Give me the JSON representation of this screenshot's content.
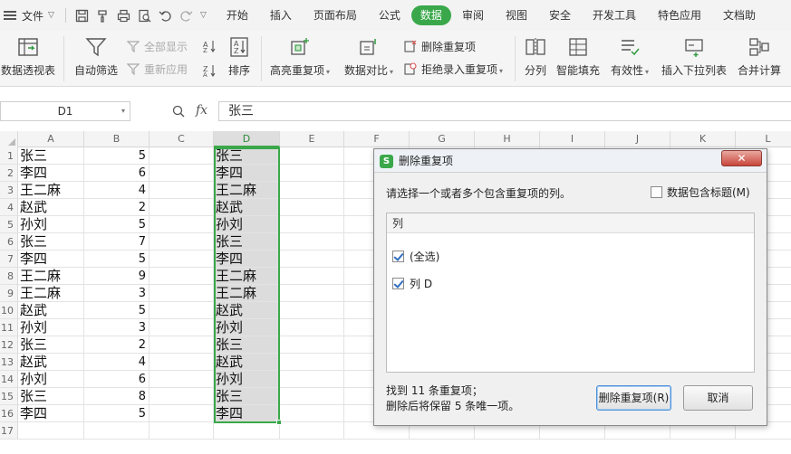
{
  "menubar": {
    "file_label": "文件",
    "tabs": [
      "开始",
      "插入",
      "页面布局",
      "公式",
      "数据",
      "审阅",
      "视图",
      "安全",
      "开发工具",
      "特色应用",
      "文档助"
    ],
    "active_tab": "数据"
  },
  "ribbon": {
    "pivot": "数据透视表",
    "autofilter": "自动筛选",
    "show_all": "全部显示",
    "reapply": "重新应用",
    "sort": "排序",
    "highlight_dup": "高亮重复项",
    "data_compare": "数据对比",
    "remove_dup": "删除重复项",
    "reject_dup": "拒绝录入重复项",
    "split_col": "分列",
    "flash_fill": "智能填充",
    "validity": "有效性",
    "insert_dropdown": "插入下拉列表",
    "consolidate": "合并计算"
  },
  "formula_bar": {
    "name_box": "D1",
    "fx": "fx",
    "content": "张三"
  },
  "sheet": {
    "columns": [
      "A",
      "B",
      "C",
      "D",
      "E",
      "F",
      "G",
      "H",
      "I",
      "J",
      "K",
      "L"
    ],
    "row_numbers": [
      "1",
      "2",
      "3",
      "4",
      "5",
      "6",
      "7",
      "8",
      "9",
      "10",
      "11",
      "12",
      "13",
      "14",
      "15",
      "16",
      "17"
    ],
    "rows": [
      {
        "a": "张三",
        "b": "5",
        "d": "张三"
      },
      {
        "a": "李四",
        "b": "6",
        "d": "李四"
      },
      {
        "a": "王二麻",
        "b": "4",
        "d": "王二麻"
      },
      {
        "a": "赵武",
        "b": "2",
        "d": "赵武"
      },
      {
        "a": "孙刘",
        "b": "5",
        "d": "孙刘"
      },
      {
        "a": "张三",
        "b": "7",
        "d": "张三"
      },
      {
        "a": "李四",
        "b": "5",
        "d": "李四"
      },
      {
        "a": "王二麻",
        "b": "9",
        "d": "王二麻"
      },
      {
        "a": "王二麻",
        "b": "3",
        "d": "王二麻"
      },
      {
        "a": "赵武",
        "b": "5",
        "d": "赵武"
      },
      {
        "a": "孙刘",
        "b": "3",
        "d": "孙刘"
      },
      {
        "a": "张三",
        "b": "2",
        "d": "张三"
      },
      {
        "a": "赵武",
        "b": "4",
        "d": "赵武"
      },
      {
        "a": "孙刘",
        "b": "6",
        "d": "孙刘"
      },
      {
        "a": "张三",
        "b": "8",
        "d": "张三"
      },
      {
        "a": "李四",
        "b": "5",
        "d": "李四"
      },
      {
        "a": "",
        "b": "",
        "d": ""
      }
    ]
  },
  "dialog": {
    "title": "删除重复项",
    "close": "✕",
    "prompt": "请选择一个或者多个包含重复项的列。",
    "header_checkbox": "数据包含标题(M)",
    "header_checked": false,
    "list_header": "列",
    "items": [
      {
        "label": "(全选)",
        "checked": true
      },
      {
        "label": "列 D",
        "checked": true
      }
    ],
    "found_line1": "找到 11 条重复项；",
    "found_line2": "删除后将保留 5 条唯一项。",
    "ok_button": "删除重复项(R)",
    "cancel_button": "取消"
  },
  "colors": {
    "accent": "#3aa84a",
    "selection_fill": "#dcdcdc"
  }
}
